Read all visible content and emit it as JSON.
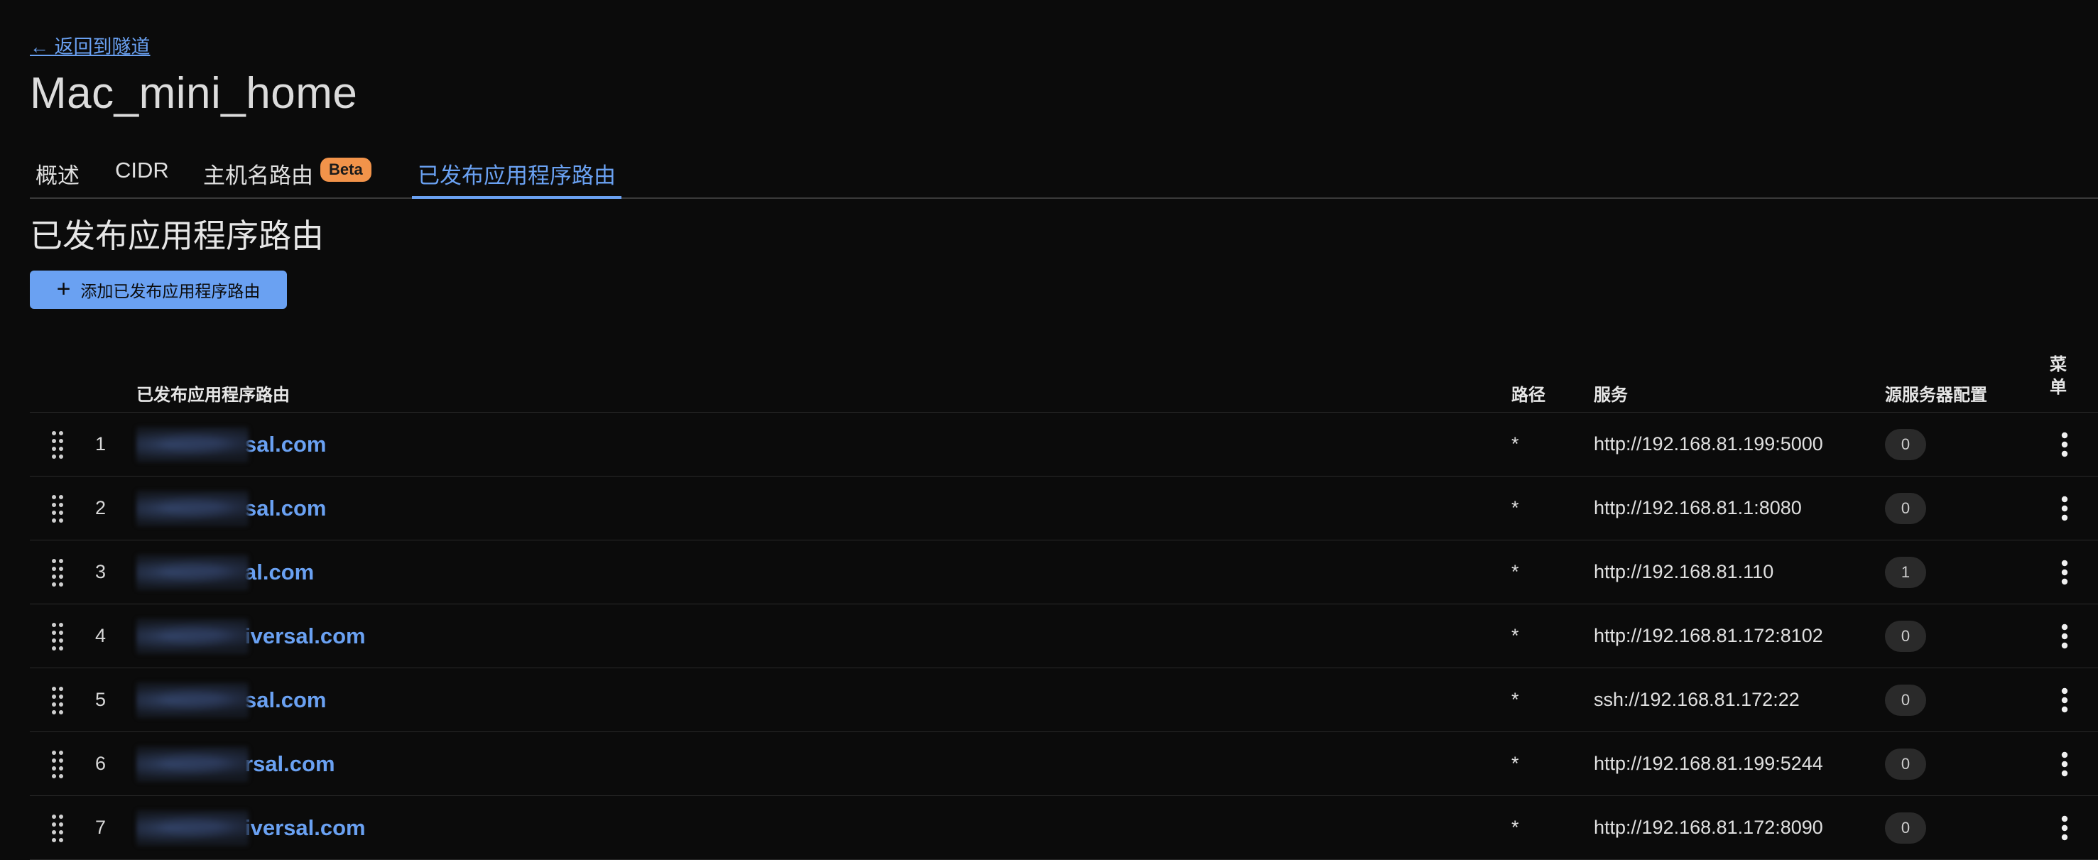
{
  "back_link": "← 返回到隧道",
  "page_title": "Mac_mini_home",
  "tabs": [
    {
      "label": "概述"
    },
    {
      "label": "CIDR"
    },
    {
      "label": "主机名路由",
      "badge": "Beta"
    },
    {
      "label": "已发布应用程序路由"
    }
  ],
  "section_title": "已发布应用程序路由",
  "add_button_label": "添加已发布应用程序路由",
  "table": {
    "headers": {
      "hostname": "已发布应用程序路由",
      "path": "路径",
      "service": "服务",
      "origin_config": "源服务器配置",
      "menu": "菜单"
    },
    "rows": [
      {
        "num": "1",
        "hostname": "sal.com",
        "path": "*",
        "service": "http://192.168.81.199:5000",
        "config_count": "0"
      },
      {
        "num": "2",
        "hostname": "sal.com",
        "path": "*",
        "service": "http://192.168.81.1:8080",
        "config_count": "0"
      },
      {
        "num": "3",
        "hostname": "al.com",
        "path": "*",
        "service": "http://192.168.81.110",
        "config_count": "1"
      },
      {
        "num": "4",
        "hostname": "iversal.com",
        "path": "*",
        "service": "http://192.168.81.172:8102",
        "config_count": "0"
      },
      {
        "num": "5",
        "hostname": "sal.com",
        "path": "*",
        "service": "ssh://192.168.81.172:22",
        "config_count": "0"
      },
      {
        "num": "6",
        "hostname": "rsal.com",
        "path": "*",
        "service": "http://192.168.81.199:5244",
        "config_count": "0"
      },
      {
        "num": "7",
        "hostname": "iversal.com",
        "path": "*",
        "service": "http://192.168.81.172:8090",
        "config_count": "0"
      }
    ]
  },
  "colors": {
    "background": "#0b0b0b",
    "accent": "#6aa1f2",
    "beta_badge": "#f2934a",
    "count_badge_bg": "#2a2a2a"
  },
  "icons": [
    "drag-handle-icon",
    "plus-icon",
    "more-vertical-icon"
  ]
}
